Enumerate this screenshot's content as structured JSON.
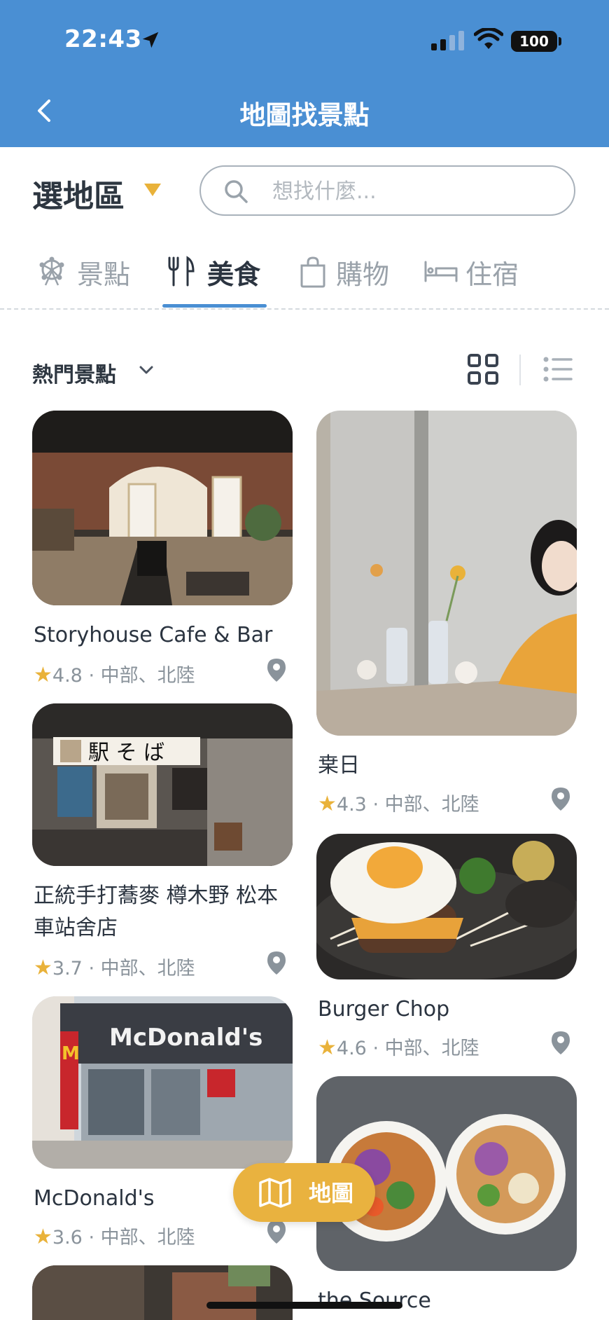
{
  "status_bar": {
    "time": "22:43",
    "battery": "100"
  },
  "header": {
    "title": "地圖找景點"
  },
  "region": {
    "label": "選地區"
  },
  "search": {
    "placeholder": "想找什麼..."
  },
  "tabs": [
    {
      "label": "景點",
      "icon": "ferris-wheel-icon",
      "active": false
    },
    {
      "label": "美食",
      "icon": "fork-knife-icon",
      "active": true
    },
    {
      "label": "購物",
      "icon": "shopping-bag-icon",
      "active": false
    },
    {
      "label": "住宿",
      "icon": "bed-icon",
      "active": false
    }
  ],
  "sort": {
    "label": "熱門景點"
  },
  "colors": {
    "primary": "#4a8fd3",
    "star": "#e9b23a",
    "fab": "#e9b23f"
  },
  "cards": [
    {
      "name": "Storyhouse Cafe & Bar",
      "rating": "4.8",
      "area": "中部、北陸"
    },
    {
      "name": "枽日",
      "rating": "4.3",
      "area": "中部、北陸"
    },
    {
      "name": "正統手打蕎麥 樽木野 松本車站舍店",
      "rating": "3.7",
      "area": "中部、北陸"
    },
    {
      "name": "Burger Chop",
      "rating": "4.6",
      "area": "中部、北陸"
    },
    {
      "name": "McDonald's",
      "rating": "3.6",
      "area": "中部、北陸"
    },
    {
      "name": "the Source",
      "rating": "",
      "area": ""
    }
  ],
  "fab": {
    "label": "地圖"
  }
}
